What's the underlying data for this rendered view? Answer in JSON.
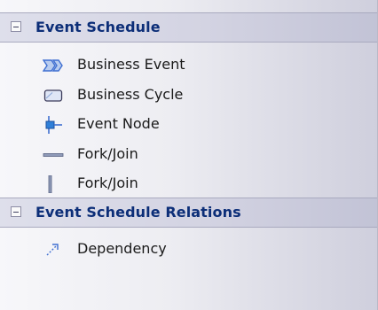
{
  "toolbox": {
    "groups": [
      {
        "title": "Event Schedule",
        "collapse_icon": "minus-collapse-icon",
        "items": [
          {
            "label": "Business Event",
            "icon": "business-event-icon"
          },
          {
            "label": "Business Cycle",
            "icon": "business-cycle-icon"
          },
          {
            "label": "Event Node",
            "icon": "event-node-icon"
          },
          {
            "label": "Fork/Join",
            "icon": "fork-join-horizontal-icon"
          },
          {
            "label": "Fork/Join",
            "icon": "fork-join-vertical-icon"
          }
        ]
      },
      {
        "title": "Event Schedule Relations",
        "collapse_icon": "minus-collapse-icon",
        "items": [
          {
            "label": "Dependency",
            "icon": "dependency-arrow-icon"
          }
        ]
      }
    ]
  },
  "colors": {
    "group_title": "#0c2e78",
    "item_text": "#1a1a1a",
    "icon_blue": "#3f6fd1",
    "icon_light_blue": "#b8ccef"
  }
}
